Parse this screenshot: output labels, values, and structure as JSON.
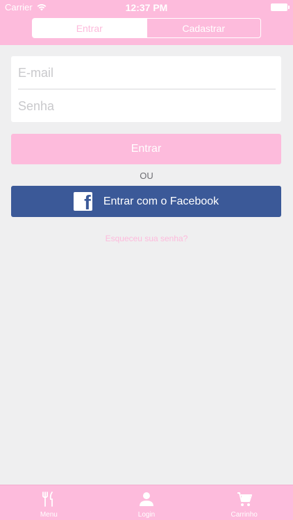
{
  "status_bar": {
    "carrier": "Carrier",
    "time": "12:37 PM"
  },
  "segmented": {
    "login": "Entrar",
    "signup": "Cadastrar"
  },
  "form": {
    "email_placeholder": "E-mail",
    "password_placeholder": "Senha"
  },
  "login_button": "Entrar",
  "or_text": "OU",
  "facebook_button": "Entrar com o Facebook",
  "forgot_password": "Esqueceu sua senha?",
  "tabbar": {
    "menu": "Menu",
    "login": "Login",
    "cart": "Carrinho"
  },
  "colors": {
    "accent_pink": "#fdbbdc",
    "facebook_blue": "#3b5998",
    "background": "#efeff0"
  }
}
